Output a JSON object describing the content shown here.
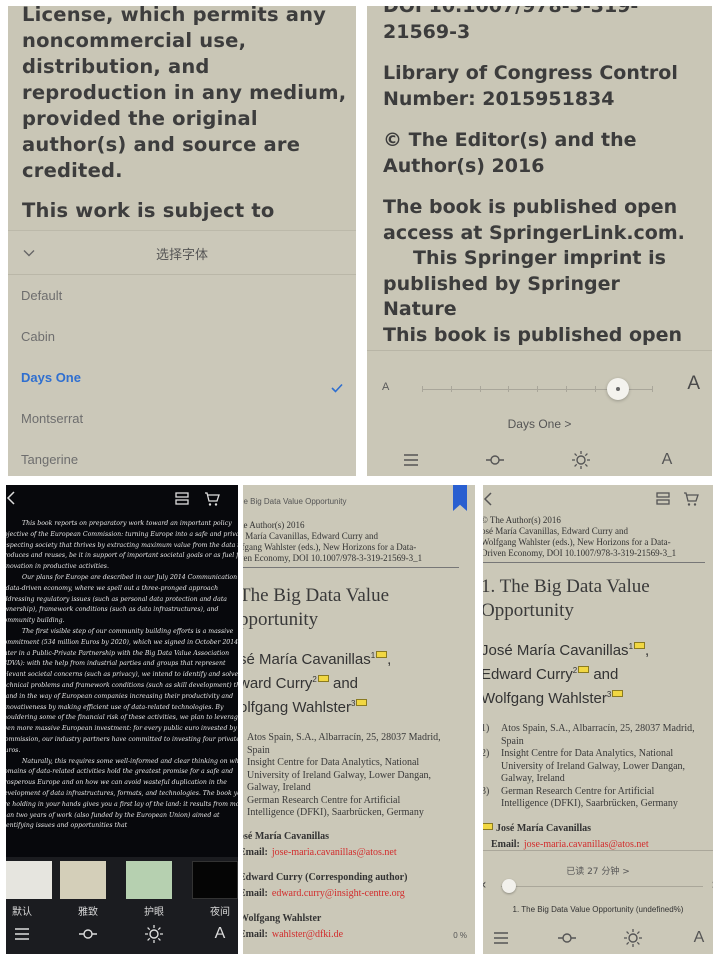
{
  "panel1": {
    "book_lines": [
      "License, which permits any",
      "noncommercial use,",
      "distribution, and",
      "reproduction in any medium,",
      "provided the original",
      "author(s) and source are",
      "credited."
    ],
    "book_lines2": [
      "This work is subject to"
    ],
    "font_sheet_title": "选择字体",
    "fonts": [
      "Default",
      "Cabin",
      "Days One",
      "Montserrat",
      "Tangerine"
    ],
    "selected_font": "Days One",
    "colors": {
      "selected": "#2f6fd0"
    }
  },
  "panel2": {
    "book_top": "DOI 10.1007/978-3-319-",
    "book_top2": "21569-3",
    "loc_lines": [
      "Library of Congress Control",
      "Number: 2015951834"
    ],
    "copyright_lines": [
      "© The Editor(s) and the",
      "Author(s) 2016"
    ],
    "open_access_lines": [
      "The book is published open",
      "access at SpringerLink.com."
    ],
    "imprint_lines": [
      "This Springer imprint is",
      "published by Springer",
      "Nature"
    ],
    "cut_line": "This book is published open",
    "size_small_label": "A",
    "size_large_label": "A",
    "font_size_level": 0.85,
    "current_font_link": "Days One >",
    "bottom_a_label": "A"
  },
  "panel3": {
    "paragraphs": [
      "This book reports on preparatory work toward an important policy objective of the European Commission: turning Europe into a safe and privacy-respecting society that thrives by extracting maximum value from the data it produces and reuses, be it in support of important societal goals or as fuel for innovation in productive activities.",
      "Our plans for Europe are described in our July 2014 Communication on a data-driven economy, where we spell out a three-pronged approach addressing regulatory issues (such as personal data protection and data ownership), framework conditions (such as data infrastructures), and community building.",
      "The first visible step of our community building efforts is a massive commitment (534 million Euros by 2020), which we signed in October 2014, to enter in a Public-Private Partnership with the Big Data Value Association (BDVA): with the help from industrial parties and groups that represent relevant societal concerns (such as privacy), we intend to identify and solve technical problems and framework conditions (such as skill development) that stand in the way of European companies increasing their productivity and innovativeness by making efficient use of data-related technologies. By shouldering some of the financial risk of these activities, we plan to leverage even more massive European investment: for every public euro invested by the Commission, our industry partners have committed to investing four private Euros.",
      "Naturally, this requires some well-informed and clear thinking on which domains of data-related activities hold the greatest promise for a safe and prosperous Europe and on how we can avoid wasteful duplication in the development of data infrastructures, formats, and technologies. The book you are holding in your hands gives you a first lay of the land: it results from more than two years of work (also funded by the European Union) aimed at identifying issues and opportunities that"
    ],
    "themes": [
      {
        "label": "默认",
        "color": "#e6e5df"
      },
      {
        "label": "雅致",
        "color": "#d4cfb9"
      },
      {
        "label": "护眼",
        "color": "#b6d0b0"
      },
      {
        "label": "夜间",
        "color": "#050505"
      }
    ],
    "bottom_a_label": "A"
  },
  "panel4": {
    "running_header": "he Big Data Value Opportunity",
    "meta_lines": [
      "he Author(s) 2016",
      "é María Cavanillas, Edward Curry and",
      "lfgang Wahlster (eds.), New Horizons for a Data-",
      "ven Economy, DOI 10.1007/978-3-319-21569-3_1"
    ],
    "chapter_lines": [
      "The Big Data Value",
      "pportunity"
    ],
    "author_lines": [
      "sé María Cavanillas",
      "ward Curry",
      " and",
      "olfgang Wahlster"
    ],
    "affiliations": [
      "Atos Spain, S.A., Albarracín, 25, 28037 Madrid,",
      "Spain",
      "Insight Centre for Data Analytics, National",
      "University of Ireland Galway, Lower Dangan,",
      "Galway, Ireland",
      "German Research Centre for Artificial",
      "Intelligence (DFKI), Saarbrücken, Germany"
    ],
    "contacts": [
      {
        "name": "osé María Cavanillas",
        "label": "Email:",
        "email": "jose-maria.cavanillas@atos.net"
      },
      {
        "name": "Edward Curry (Corresponding author)",
        "label": "Email:",
        "email": "edward.curry@insight-centre.org"
      },
      {
        "name": "Wolfgang Wahlster",
        "label": "Email:",
        "email": "wahlster@dfki.de"
      }
    ],
    "percent": "0 %"
  },
  "panel5": {
    "meta_lines": [
      "© The Author(s) 2016",
      "osé María Cavanillas, Edward Curry and",
      "Wolfgang Wahlster (eds.), New Horizons for a Data-",
      "Driven Economy, DOI 10.1007/978-3-319-21569-3_1"
    ],
    "chapter_lines": [
      "1. The Big Data Value",
      "Opportunity"
    ],
    "author_lines": [
      "José María Cavanillas",
      "Edward Curry",
      " and",
      "Wolfgang Wahlster"
    ],
    "affiliations": [
      {
        "num": "1)",
        "lines": [
          "Atos Spain, S.A., Albarracín, 25, 28037 Madrid,",
          "Spain"
        ]
      },
      {
        "num": "2)",
        "lines": [
          "Insight Centre for Data Analytics, National",
          "University of Ireland Galway, Lower Dangan,",
          "Galway, Ireland"
        ]
      },
      {
        "num": "3)",
        "lines": [
          "German Research Centre for Artificial",
          "Intelligence (DFKI), Saarbrücken, Germany"
        ]
      }
    ],
    "contact": {
      "name": "José María Cavanillas",
      "label": "Email:",
      "email": "jose-maria.cavanillas@atos.net"
    },
    "read_time": "已读 27 分钟 >",
    "progress_fraction": 0.0,
    "progress_chapter": "1. The Big Data Value Opportunity  (undefined%)",
    "bottom_a_label": "A"
  }
}
